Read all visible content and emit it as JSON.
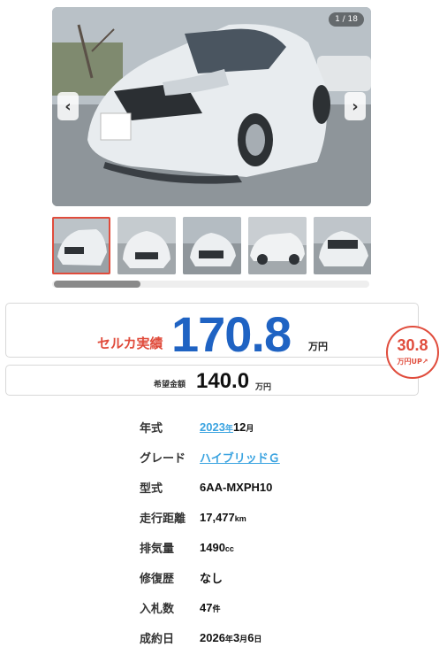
{
  "gallery": {
    "counter": "1 / 18",
    "prev_icon": "chevron-left-icon",
    "next_icon": "chevron-right-icon",
    "thumbnail_count": 5,
    "active_index": 0
  },
  "price": {
    "label": "セルカ実績",
    "value": "170.8",
    "unit": "万円"
  },
  "hope": {
    "label": "希望金額",
    "value": "140.0",
    "unit": "万円"
  },
  "up_badge": {
    "value": "30.8",
    "label": "万円UP",
    "icon": "arrow-up-icon"
  },
  "specs": [
    {
      "key": "年式",
      "parts": [
        {
          "t": "2023",
          "link": true
        },
        {
          "t": "年",
          "small": true,
          "link": true
        },
        {
          "t": "12"
        },
        {
          "t": "月",
          "small": true
        }
      ]
    },
    {
      "key": "グレード",
      "parts": [
        {
          "t": "ハイブリッドＧ",
          "link": true
        }
      ]
    },
    {
      "key": "型式",
      "parts": [
        {
          "t": "6AA-MXPH10"
        }
      ]
    },
    {
      "key": "走行距離",
      "parts": [
        {
          "t": "17,477"
        },
        {
          "t": "km",
          "small": true
        }
      ]
    },
    {
      "key": "排気量",
      "parts": [
        {
          "t": "1490"
        },
        {
          "t": "cc",
          "small": true
        }
      ]
    },
    {
      "key": "修復歴",
      "parts": [
        {
          "t": "なし"
        }
      ]
    },
    {
      "key": "入札数",
      "parts": [
        {
          "t": "47"
        },
        {
          "t": "件",
          "small": true
        }
      ]
    },
    {
      "key": "成約日",
      "parts": [
        {
          "t": "2026"
        },
        {
          "t": "年",
          "small": true
        },
        {
          "t": "3"
        },
        {
          "t": "月",
          "small": true
        },
        {
          "t": "6"
        },
        {
          "t": "日",
          "small": true
        }
      ]
    }
  ],
  "colors": {
    "accent_red": "#e04c3c",
    "price_blue": "#1f63c3",
    "link_blue": "#3aa3e0"
  }
}
